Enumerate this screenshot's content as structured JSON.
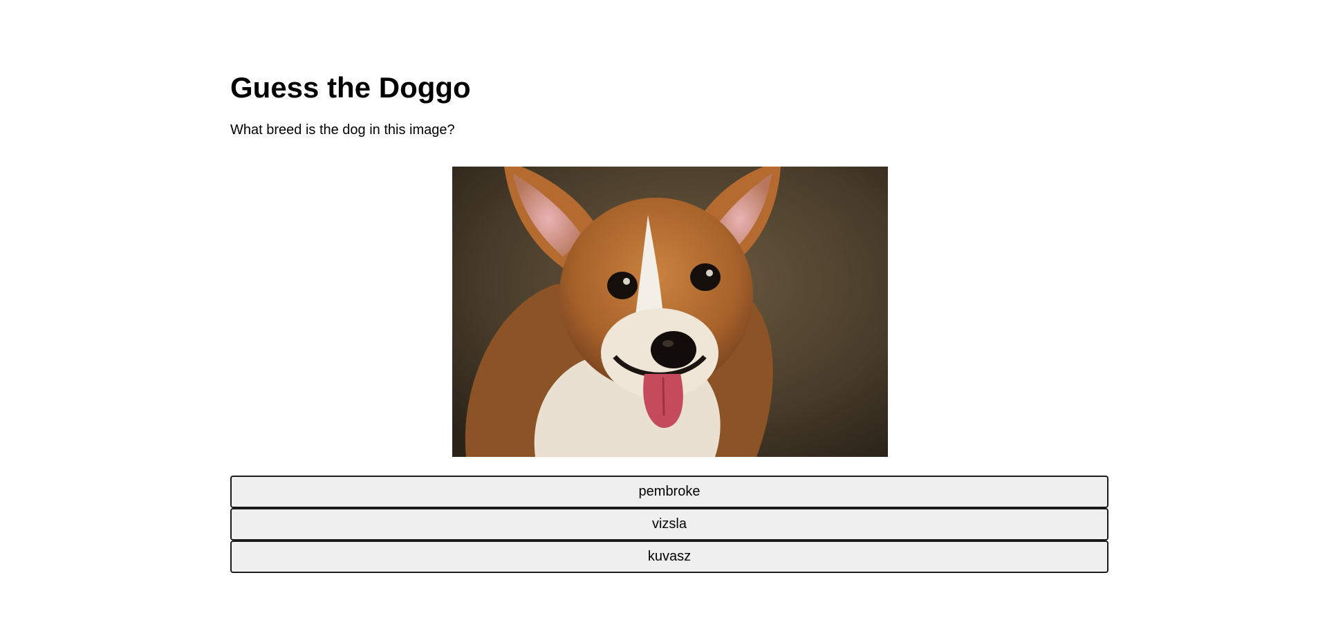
{
  "header": {
    "title": "Guess the Doggo",
    "question": "What breed is the dog in this image?"
  },
  "image": {
    "alt": "dog photo",
    "subject": "corgi-dog"
  },
  "answers": [
    {
      "label": "pembroke"
    },
    {
      "label": "vizsla"
    },
    {
      "label": "kuvasz"
    }
  ]
}
